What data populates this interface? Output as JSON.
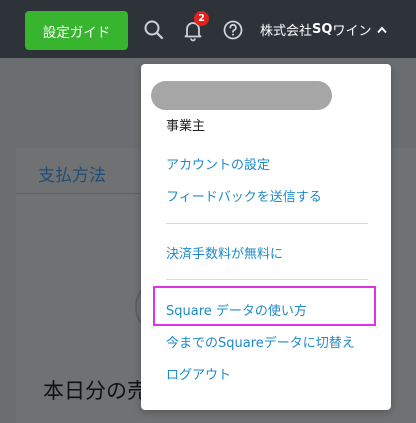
{
  "topbar": {
    "guide_button": "設定ガイド",
    "notification_count": "2",
    "account_name": "株式会社",
    "account_name_bold": "SQ",
    "account_name_suffix": "ワイン"
  },
  "background": {
    "tab_label": "支払方法",
    "heading": "本日分の売"
  },
  "dropdown": {
    "role": "事業主",
    "group1": [
      "アカウントの設定",
      "フィードバックを送信する"
    ],
    "group2": [
      "決済手数料が無料に"
    ],
    "group3": [
      "Square データの使い方",
      "今までのSquareデータに切替え",
      "ログアウト"
    ]
  },
  "colors": {
    "topbar": "#2d3338",
    "guide_button": "#38b52f",
    "badge": "#e2231a",
    "link": "#1d8ac9",
    "highlight": "#e033e6"
  }
}
